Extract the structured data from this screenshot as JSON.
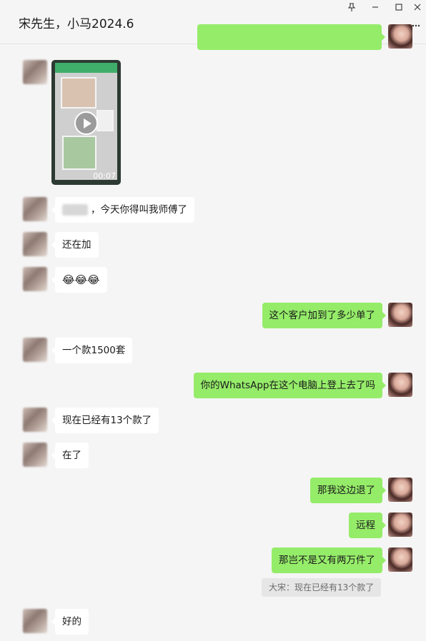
{
  "window": {
    "title": "宋先生，小马2024.6",
    "pin_icon": "pin-icon",
    "minimize_icon": "minimize-icon",
    "maximize_icon": "maximize-icon",
    "close_icon": "close-icon",
    "more_icon": "more-icon"
  },
  "video": {
    "duration": "00:07"
  },
  "messages": [
    {
      "side": "in",
      "text": "，今天你得叫我师傅了"
    },
    {
      "side": "in",
      "text": "还在加"
    },
    {
      "side": "in",
      "text": "😂😂😂"
    },
    {
      "side": "out",
      "text": "这个客户加到了多少单了"
    },
    {
      "side": "in",
      "text": "一个款1500套"
    },
    {
      "side": "out",
      "text": "你的WhatsApp在这个电脑上登上去了吗"
    },
    {
      "side": "in",
      "text": "现在已经有13个款了"
    },
    {
      "side": "in",
      "text": "在了"
    },
    {
      "side": "out",
      "text": "那我这边退了"
    },
    {
      "side": "out",
      "text": "远程"
    },
    {
      "side": "out",
      "text": "那岂不是又有两万件了"
    },
    {
      "side": "in",
      "text": "好的"
    }
  ],
  "quote": {
    "text": "大宋：现在已经有13个款了"
  },
  "colors": {
    "out_bubble": "#95ec69",
    "in_bubble": "#ffffff",
    "background": "#f5f5f5"
  }
}
